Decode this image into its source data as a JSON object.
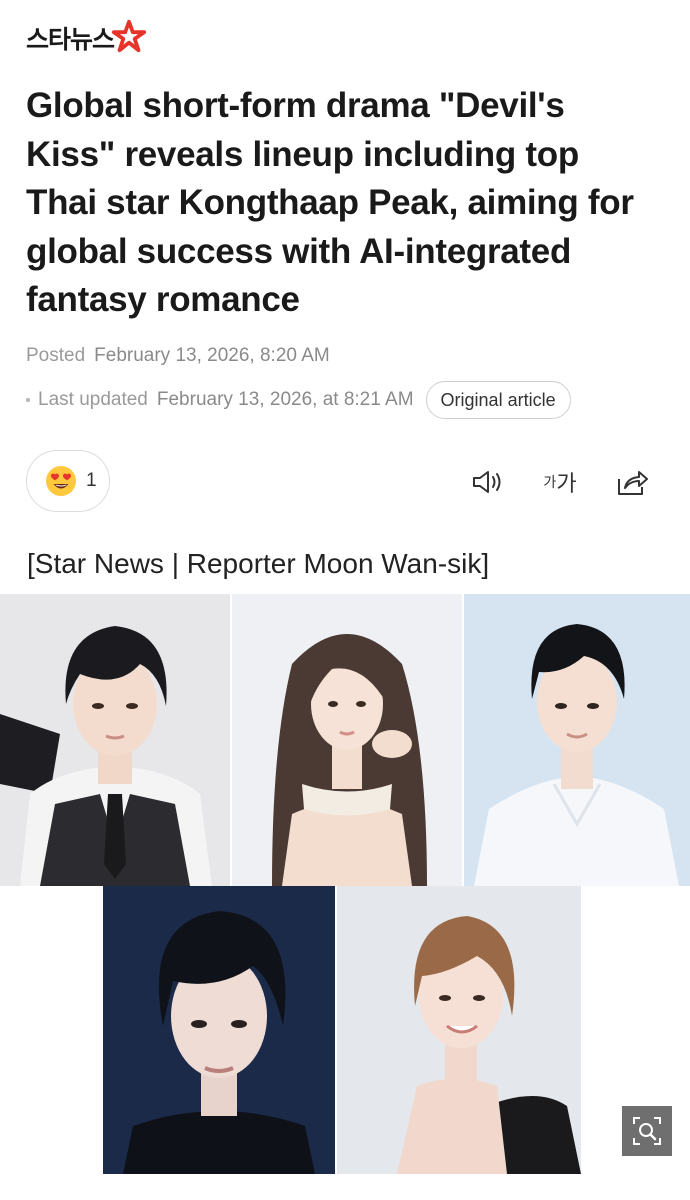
{
  "outlet": {
    "logo_text": "스타뉴스"
  },
  "article": {
    "headline": "Global short-form drama \"Devil's Kiss\" reveals lineup including top Thai star Kongthaap Peak, aiming for global success with AI-integrated fantasy romance",
    "posted_label": "Posted",
    "posted_value": "February 13, 2026, 8:20 AM",
    "updated_label": "Last updated",
    "updated_value": "February 13, 2026, at 8:21 AM",
    "original_button": "Original article",
    "byline": "[Star News | Reporter Moon Wan-sik]"
  },
  "reaction": {
    "icon": "heart-eyes-emoji-icon",
    "count": "1"
  },
  "toolbar": {
    "font_small": "가",
    "font_big": "가",
    "icons": [
      "speaker-icon",
      "font-size-icon",
      "share-icon"
    ]
  },
  "photos": [
    {
      "name": "photo-actor-1",
      "bg": "#e7e7ea"
    },
    {
      "name": "photo-actress-1",
      "bg": "#eef0f3"
    },
    {
      "name": "photo-actor-2",
      "bg": "#d6e4f2"
    },
    {
      "name": "photo-actor-3",
      "bg": "#1c2a4a"
    },
    {
      "name": "photo-actress-2",
      "bg": "#e4e8ec"
    }
  ],
  "colors": {
    "logo_star": "#e8332a",
    "headline": "#1a1a1a",
    "meta": "#8a8a8a"
  }
}
